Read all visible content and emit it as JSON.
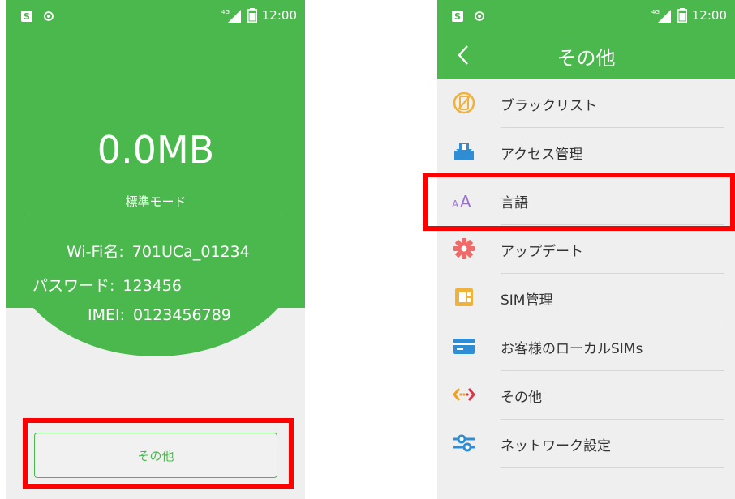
{
  "status_bar": {
    "s_label": "S",
    "network": "4G",
    "time": "12:00"
  },
  "left_screen": {
    "data_used": "0.0MB",
    "mode": "標準モード",
    "wifi_label": "Wi-Fi名:",
    "wifi_value": "701UCa_01234",
    "password_label": "パスワード:",
    "password_value": "123456",
    "imei_label": "IMEI:",
    "imei_value": "0123456789",
    "other_button": "その他"
  },
  "right_screen": {
    "title": "その他",
    "items": [
      {
        "label": "ブラックリスト",
        "icon": "blacklist-icon"
      },
      {
        "label": "アクセス管理",
        "icon": "access-management-icon"
      },
      {
        "label": "言語",
        "icon": "language-icon"
      },
      {
        "label": "アップデート",
        "icon": "update-gear-icon"
      },
      {
        "label": "SIM管理",
        "icon": "sim-management-icon"
      },
      {
        "label": "お客様のローカルSIMs",
        "icon": "local-sims-card-icon"
      },
      {
        "label": "その他",
        "icon": "other-code-icon"
      },
      {
        "label": "ネットワーク設定",
        "icon": "network-settings-sliders-icon"
      }
    ]
  },
  "colors": {
    "brand_green": "#4bb84d",
    "highlight_red": "#ff0000",
    "background": "#efefef"
  }
}
